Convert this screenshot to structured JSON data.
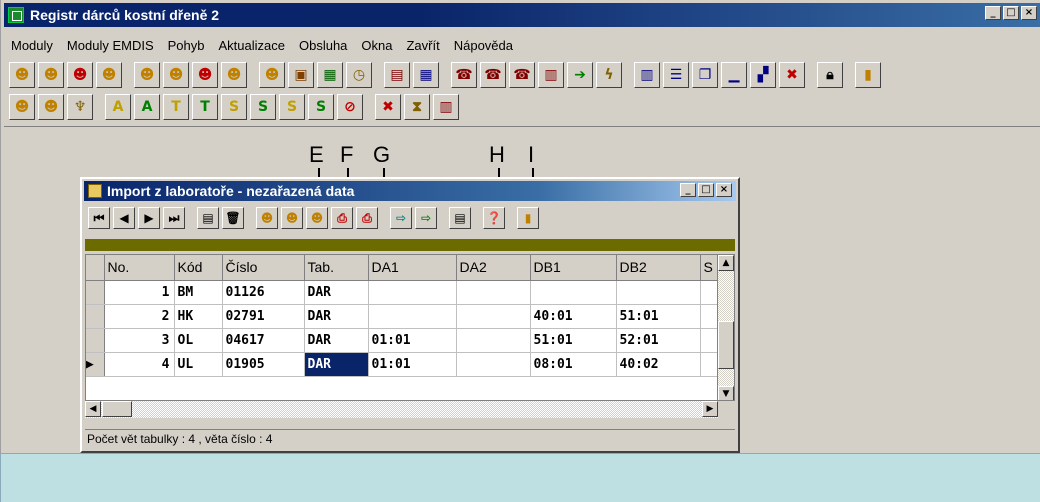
{
  "app": {
    "title": "Registr dárců kostní dřeně 2",
    "window_buttons": [
      "_",
      "□",
      "×"
    ]
  },
  "menu": [
    "Moduly",
    "Moduly EMDIS",
    "Pohyb",
    "Aktualizace",
    "Obsluha",
    "Okna",
    "Zavřít",
    "Nápověda"
  ],
  "inner_window": {
    "title": "Import z laboratoře - nezařazená data",
    "window_buttons": [
      "_",
      "□",
      "×"
    ],
    "status": "Počet vět tabulky : 4 , věta číslo : 4"
  },
  "annotations": [
    "E",
    "F",
    "G",
    "H",
    "I"
  ],
  "table": {
    "columns": [
      "No.",
      "Kód",
      "Číslo",
      "Tab.",
      "DA1",
      "DA2",
      "DB1",
      "DB2",
      "S"
    ],
    "rows": [
      {
        "no": "1",
        "kod": "BM",
        "cislo": "01126",
        "tab": "DAR",
        "da1": "",
        "da2": "",
        "db1": "",
        "db2": ""
      },
      {
        "no": "2",
        "kod": "HK",
        "cislo": "02791",
        "tab": "DAR",
        "da1": "",
        "da2": "",
        "db1": "40:01",
        "db2": "51:01"
      },
      {
        "no": "3",
        "kod": "OL",
        "cislo": "04617",
        "tab": "DAR",
        "da1": "01:01",
        "da2": "",
        "db1": "51:01",
        "db2": "52:01"
      },
      {
        "no": "4",
        "kod": "UL",
        "cislo": "01905",
        "tab": "DAR",
        "da1": "01:01",
        "da2": "",
        "db1": "08:01",
        "db2": "40:02"
      }
    ]
  },
  "colors": {
    "titlebar": "#08246b",
    "band": "#6b6b00",
    "selection": "#0a246a",
    "bottom_panel": "#bfe0e3"
  }
}
